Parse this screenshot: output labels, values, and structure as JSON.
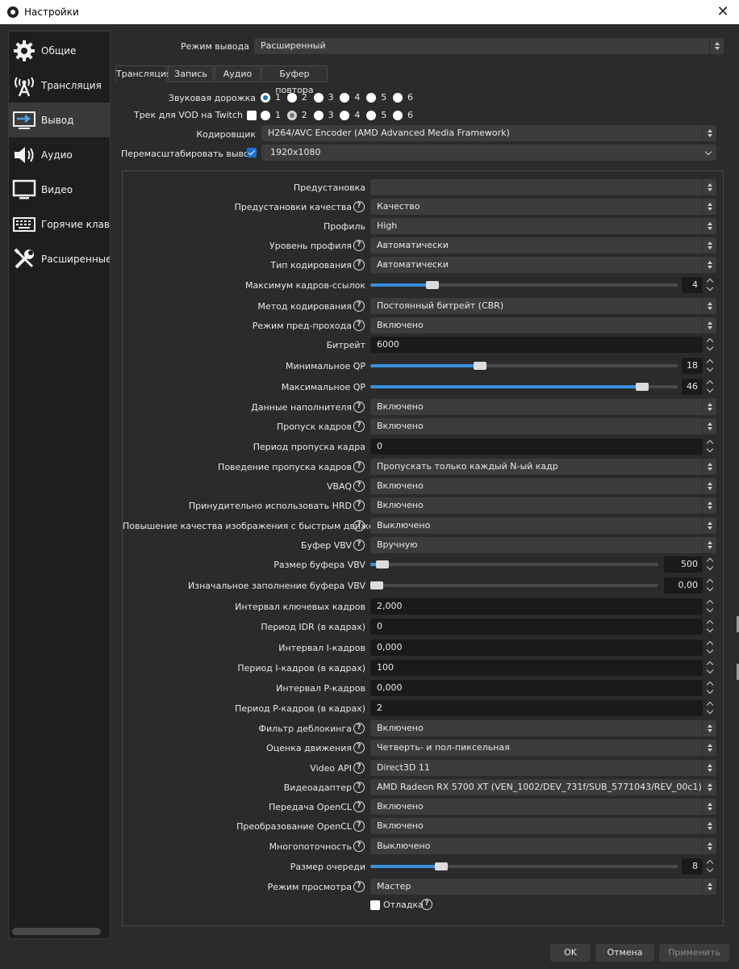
{
  "window": {
    "title": "Настройки"
  },
  "sidebar": [
    {
      "label": "Общие",
      "icon": "gear-icon"
    },
    {
      "label": "Трансляция",
      "icon": "antenna-icon"
    },
    {
      "label": "Вывод",
      "icon": "output-icon",
      "selected": true
    },
    {
      "label": "Аудио",
      "icon": "speaker-icon"
    },
    {
      "label": "Видео",
      "icon": "monitor-icon"
    },
    {
      "label": "Горячие клавиш",
      "icon": "keyboard-icon"
    },
    {
      "label": "Расширенные",
      "icon": "tools-icon"
    }
  ],
  "output_mode": {
    "label": "Режим вывода",
    "value": "Расширенный"
  },
  "tabs": [
    "Трансляция",
    "Запись",
    "Аудио",
    "Буфер повтора"
  ],
  "audio_track": {
    "label": "Звуковая дорожка",
    "options": [
      "1",
      "2",
      "3",
      "4",
      "5",
      "6"
    ],
    "selected": "1"
  },
  "vod_track": {
    "label": "Трек для VOD на Twitch",
    "options": [
      "1",
      "2",
      "3",
      "4",
      "5",
      "6"
    ],
    "selected": "2"
  },
  "encoder": {
    "label": "Кодировщик",
    "value": "H264/AVC Encoder (AMD Advanced Media Framework)"
  },
  "rescale": {
    "label": "Перемасштабировать вывод",
    "value": "1920x1080",
    "checked": true
  },
  "settings": {
    "preset": {
      "label": "Предустановка",
      "value": ""
    },
    "quality_preset": {
      "label": "Предустановки качества",
      "value": "Качество"
    },
    "profile": {
      "label": "Профиль",
      "value": "High"
    },
    "profile_level": {
      "label": "Уровень профиля",
      "value": "Автоматически"
    },
    "coding_type": {
      "label": "Тип кодирования",
      "value": "Автоматически"
    },
    "max_ref_frames": {
      "label": "Максимум кадров-ссылок",
      "value": "4",
      "level": 0.19
    },
    "rate_control": {
      "label": "Метод кодирования",
      "value": "Постоянный битрейт (CBR)"
    },
    "prepass": {
      "label": "Режим пред-прохода",
      "value": "Включено"
    },
    "bitrate": {
      "label": "Битрейт",
      "value": "6000"
    },
    "min_qp": {
      "label": "Минимальное QP",
      "value": "18",
      "level": 0.35
    },
    "max_qp": {
      "label": "Максимальное QP",
      "value": "46",
      "level": 0.9
    },
    "filler_data": {
      "label": "Данные наполнителя",
      "value": "Включено"
    },
    "frame_skipping": {
      "label": "Пропуск кадров",
      "value": "Включено"
    },
    "skip_period": {
      "label": "Период пропуска кадра",
      "value": "0"
    },
    "skip_behavior": {
      "label": "Поведение пропуска кадров",
      "value": "Пропускать только каждый N-ый кадр"
    },
    "vbaq": {
      "label": "VBAQ",
      "value": "Включено"
    },
    "enforce_hrd": {
      "label": "Принудительно использовать HRD",
      "value": "Включено"
    },
    "high_motion": {
      "label": "Повышение качества изображения с быстрым движением",
      "value": "Выключено"
    },
    "vbv_buffer": {
      "label": "Буфер VBV",
      "value": "Вручную"
    },
    "vbv_size": {
      "label": "Размер буфера VBV",
      "value": "500",
      "level": 0.02
    },
    "vbv_initial": {
      "label": "Изначальное заполнение буфера VBV",
      "value": "0,00",
      "level": 0.0
    },
    "keyframe_interval": {
      "label": "Интервал ключевых кадров",
      "value": "2,000"
    },
    "idr_period": {
      "label": "Период IDR (в кадрах)",
      "value": "0"
    },
    "i_interval": {
      "label": "Интервал I-кадров",
      "value": "0,000"
    },
    "i_period": {
      "label": "Период I-кадров (в кадрах)",
      "value": "100"
    },
    "p_interval": {
      "label": "Интервал P-кадров",
      "value": "0,000"
    },
    "p_period": {
      "label": "Период P-кадров (в кадрах)",
      "value": "2"
    },
    "deblocking": {
      "label": "Фильтр деблокинга",
      "value": "Включено"
    },
    "motion_estimation": {
      "label": "Оценка движения",
      "value": "Четверть- и пол-пиксельная"
    },
    "video_api": {
      "label": "Video API",
      "value": "Direct3D 11"
    },
    "video_adapter": {
      "label": "Видеоадаптер",
      "value": "AMD Radeon RX 5700 XT (VEN_1002/DEV_731f/SUB_5771043/REV_00c1)"
    },
    "opencl_transfer": {
      "label": "Передача OpenCL",
      "value": "Включено"
    },
    "opencl_conversion": {
      "label": "Преобразование OpenCL",
      "value": "Включено"
    },
    "multithreading": {
      "label": "Многопоточность",
      "value": "Выключено"
    },
    "queue_size": {
      "label": "Размер очереди",
      "value": "8",
      "level": 0.22
    },
    "view_mode": {
      "label": "Режим просмотра",
      "value": "Мастер"
    },
    "debug": {
      "label": "Отладка",
      "checked": false
    }
  },
  "buttons": {
    "ok": "OK",
    "cancel": "Отмена",
    "apply": "Применить"
  }
}
